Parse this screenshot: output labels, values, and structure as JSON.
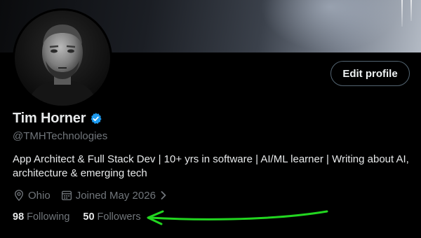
{
  "profile": {
    "name": "Tim Horner",
    "handle": "@TMHTechnologies",
    "bio": "App Architect & Full Stack Dev | 10+ yrs in software | AI/ML learner | Writing about AI, architecture & emerging tech",
    "location": "Ohio",
    "joined": "Joined May 2026",
    "verified": true
  },
  "actions": {
    "edit_profile_label": "Edit profile"
  },
  "stats": {
    "following_count": "98",
    "following_label": "Following",
    "followers_count": "50",
    "followers_label": "Followers"
  },
  "icons": {
    "verified": "verified-badge-icon",
    "location": "location-pin-icon",
    "calendar": "calendar-icon",
    "chevron": "chevron-right-icon"
  },
  "colors": {
    "background": "#000000",
    "text_primary": "#e7e9ea",
    "text_secondary": "#71767b",
    "verified_blue": "#1d9bf0",
    "button_border": "#536471",
    "annotation_green": "#22d620"
  }
}
